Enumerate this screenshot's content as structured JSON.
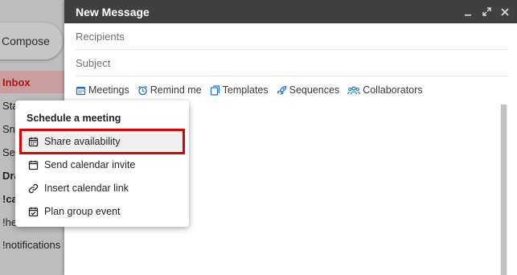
{
  "sidebar": {
    "compose_label": "Compose",
    "items": [
      {
        "label": "Inbox"
      },
      {
        "label": "Sta"
      },
      {
        "label": "Sno"
      },
      {
        "label": "Sen"
      },
      {
        "label": "Dra"
      },
      {
        "label": "!ca"
      },
      {
        "label": "!he"
      },
      {
        "label": "!notifications"
      }
    ]
  },
  "compose": {
    "title": "New Message",
    "recipients_placeholder": "Recipients",
    "subject_placeholder": "Subject",
    "toolbar": {
      "meetings": "Meetings",
      "remind_me": "Remind me",
      "templates": "Templates",
      "sequences": "Sequences",
      "collaborators": "Collaborators"
    }
  },
  "menu": {
    "title": "Schedule a meeting",
    "items": [
      {
        "label": "Share availability",
        "icon": "calendar-grid-icon"
      },
      {
        "label": "Send calendar invite",
        "icon": "calendar-icon"
      },
      {
        "label": "Insert calendar link",
        "icon": "link-icon"
      },
      {
        "label": "Plan group event",
        "icon": "calendar-check-icon"
      }
    ]
  },
  "colors": {
    "accent_blue": "#1a6fd6",
    "highlight_red": "#e00000",
    "header_bg": "#404040"
  }
}
